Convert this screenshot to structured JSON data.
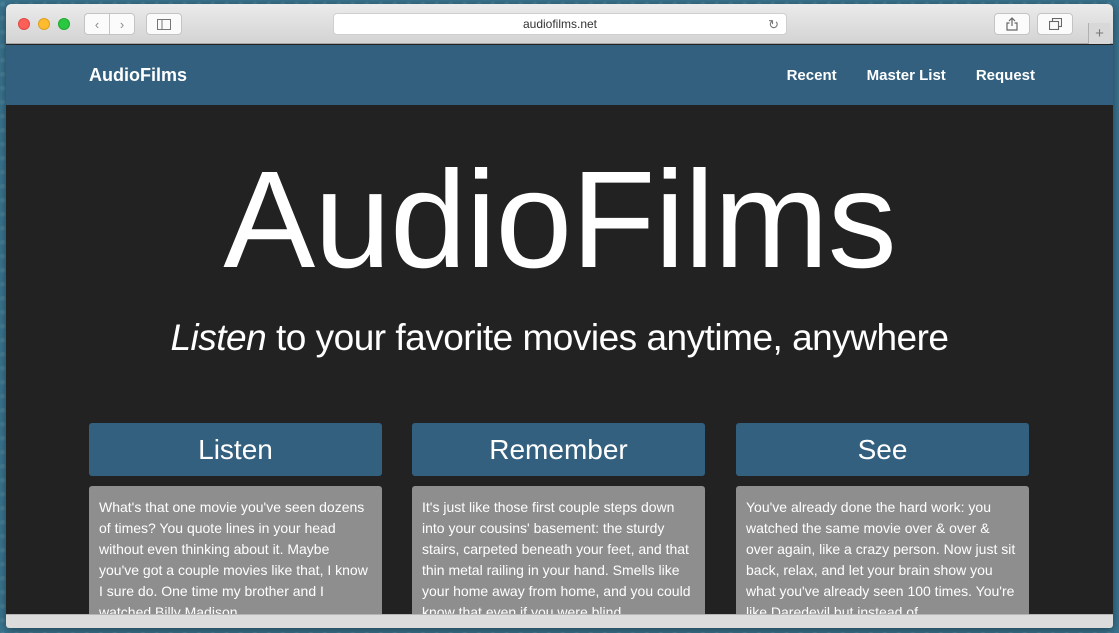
{
  "browser": {
    "url": "audiofilms.net",
    "icons": {
      "back": "chevron-left-icon",
      "forward": "chevron-right-icon",
      "sidebar": "sidebar-icon",
      "reload": "reload-icon",
      "share": "share-icon",
      "tabs": "tabs-icon",
      "new_tab": "plus-icon"
    }
  },
  "nav": {
    "brand": "AudioFilms",
    "links": [
      "Recent",
      "Master List",
      "Request"
    ]
  },
  "hero": {
    "title": "AudioFilms",
    "subtitle_emphasis": "Listen",
    "subtitle_rest": " to your favorite movies anytime, anywhere"
  },
  "features": [
    {
      "heading": "Listen",
      "body": "What's that one movie you've seen dozens of times? You quote lines in your head without even thinking about it. Maybe you've got a couple movies like that, I know I sure do. One time my brother and I watched Billy Madison"
    },
    {
      "heading": "Remember",
      "body": "It's just like those first couple steps down into your cousins' basement: the sturdy stairs, carpeted beneath your feet, and that thin metal railing in your hand. Smells like your home away from home, and you could know that even if you were blind"
    },
    {
      "heading": "See",
      "body": "You've already done the hard work: you watched the same movie over & over & over again, like a crazy person. Now just sit back, relax, and let your brain show you what you've already seen 100 times. You're like Daredevil but instead of"
    }
  ],
  "colors": {
    "nav_bg": "#33607f",
    "hero_bg": "#222222",
    "card_bg": "#8e8e8e"
  }
}
